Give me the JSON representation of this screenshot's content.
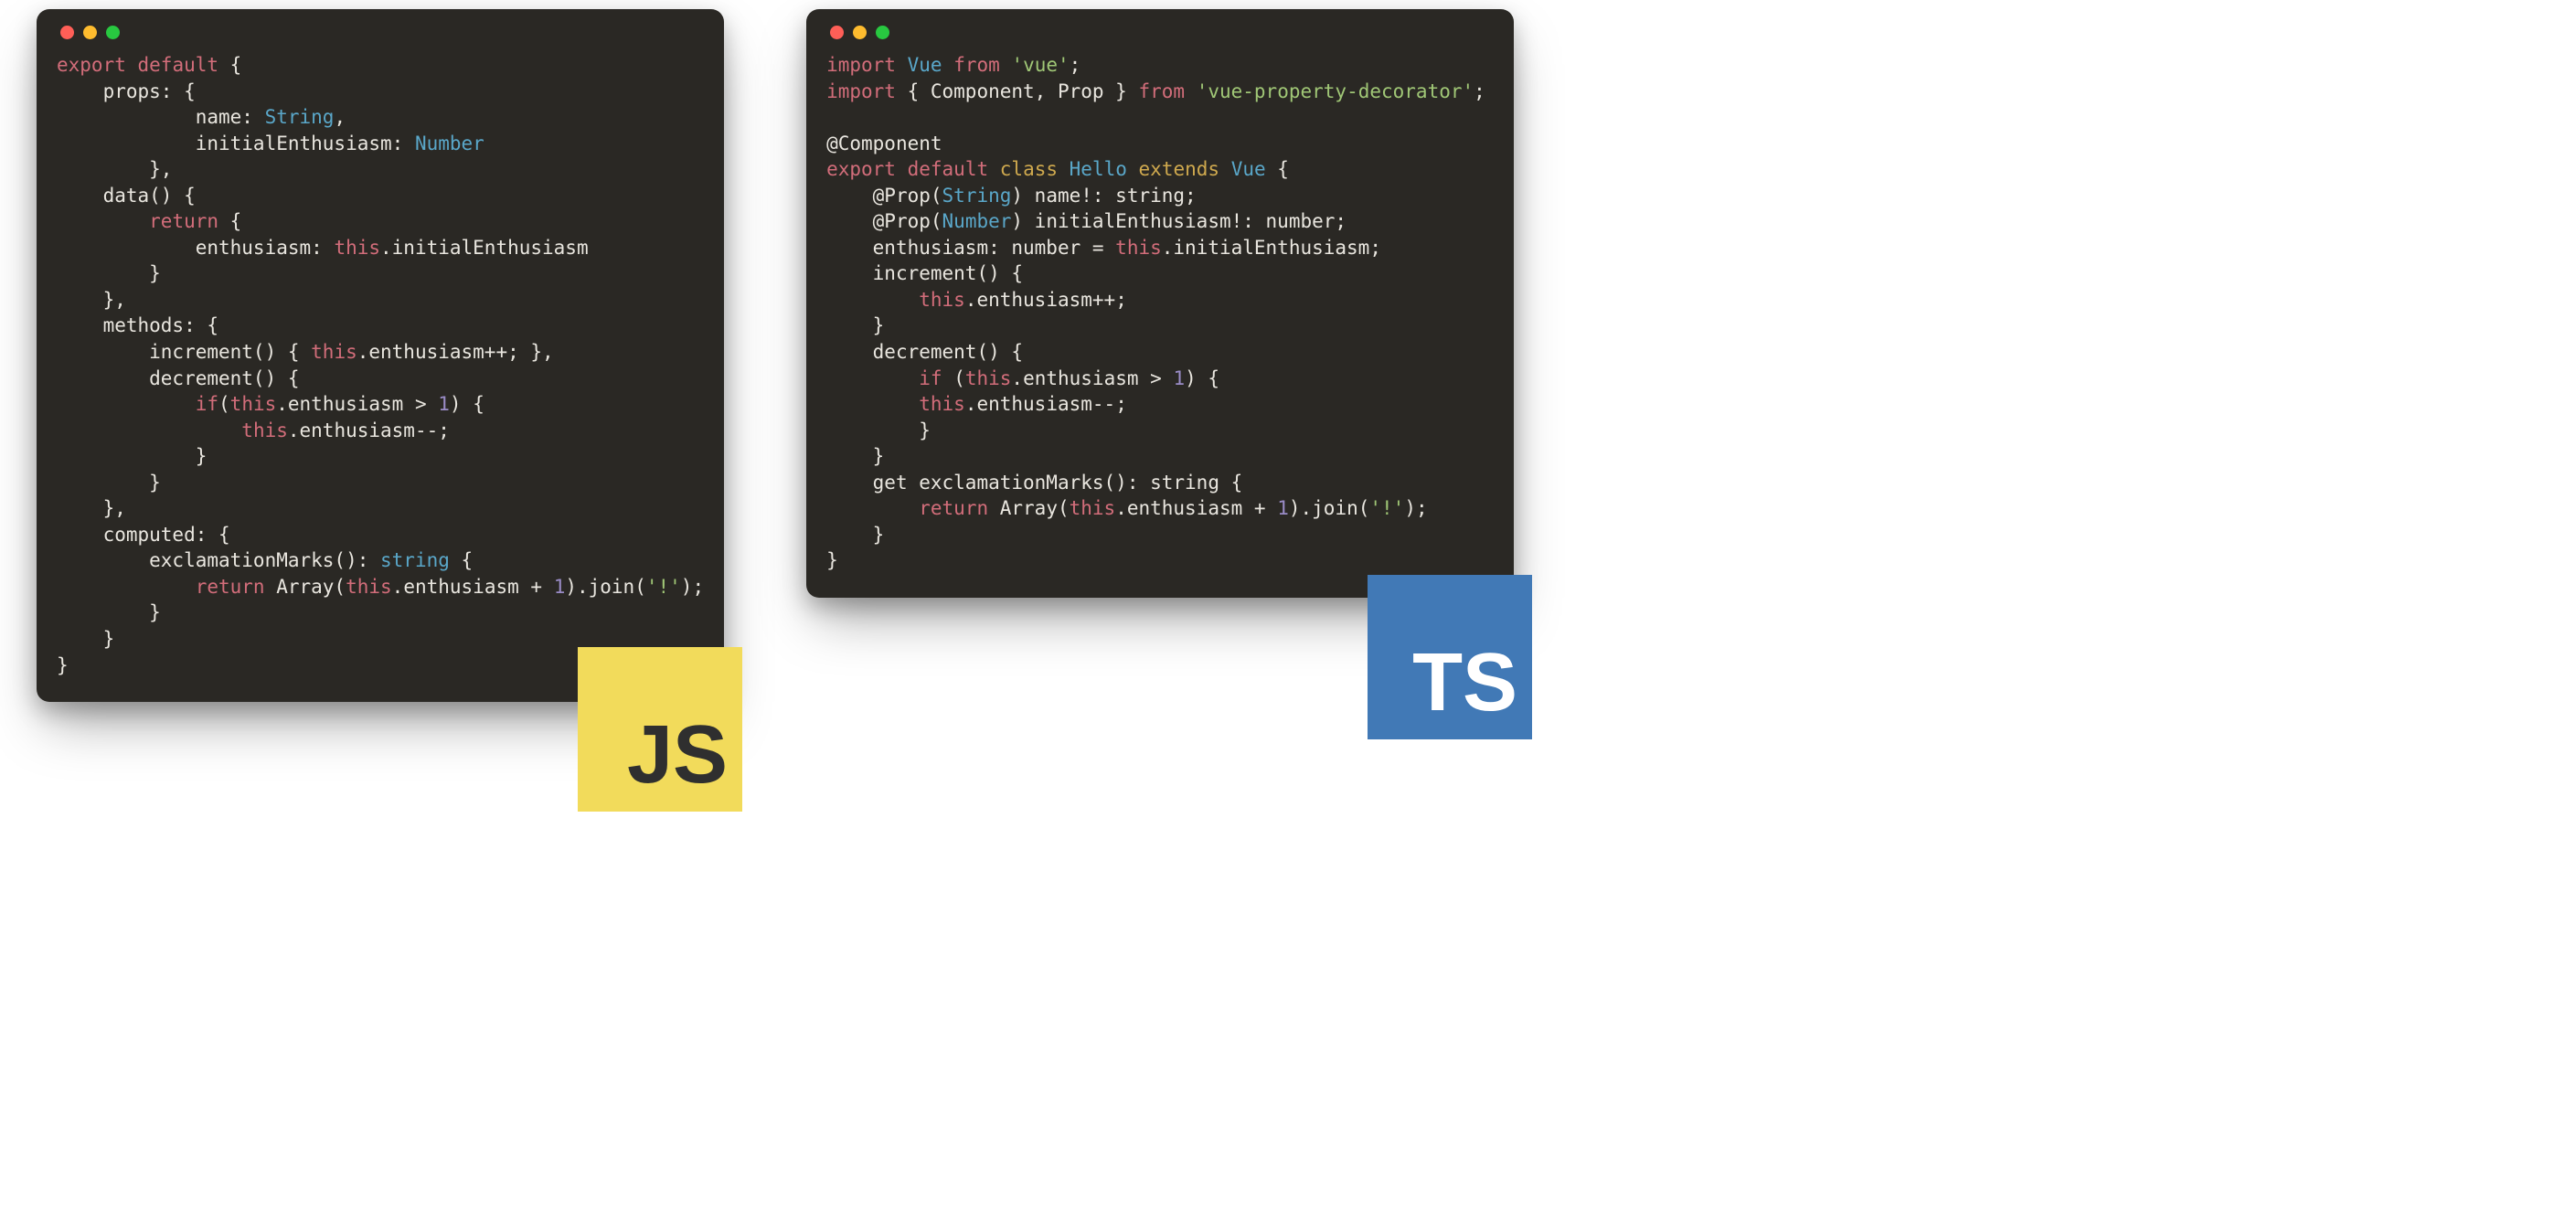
{
  "left": {
    "badge": "JS",
    "code": [
      [
        [
          "kw-red",
          "export"
        ],
        [
          "plain",
          " "
        ],
        [
          "kw-red",
          "default"
        ],
        [
          "plain",
          " {"
        ]
      ],
      [
        [
          "plain",
          "    props: {"
        ]
      ],
      [
        [
          "plain",
          "            name: "
        ],
        [
          "kw-blue",
          "String"
        ],
        [
          "plain",
          ","
        ]
      ],
      [
        [
          "plain",
          "            initialEnthusiasm: "
        ],
        [
          "kw-blue",
          "Number"
        ]
      ],
      [
        [
          "plain",
          "        },"
        ]
      ],
      [
        [
          "plain",
          "    data() {"
        ]
      ],
      [
        [
          "plain",
          "        "
        ],
        [
          "kw-red",
          "return"
        ],
        [
          "plain",
          " {"
        ]
      ],
      [
        [
          "plain",
          "            enthusiasm: "
        ],
        [
          "kw-red",
          "this"
        ],
        [
          "plain",
          ".initialEnthusiasm"
        ]
      ],
      [
        [
          "plain",
          "        }"
        ]
      ],
      [
        [
          "plain",
          "    },"
        ]
      ],
      [
        [
          "plain",
          "    methods: {"
        ]
      ],
      [
        [
          "plain",
          "        increment() { "
        ],
        [
          "kw-red",
          "this"
        ],
        [
          "plain",
          ".enthusiasm++; },"
        ]
      ],
      [
        [
          "plain",
          "        decrement() {"
        ]
      ],
      [
        [
          "plain",
          "            "
        ],
        [
          "kw-red",
          "if"
        ],
        [
          "plain",
          "("
        ],
        [
          "kw-red",
          "this"
        ],
        [
          "plain",
          ".enthusiasm > "
        ],
        [
          "kw-purple",
          "1"
        ],
        [
          "plain",
          ") {"
        ]
      ],
      [
        [
          "plain",
          "                "
        ],
        [
          "kw-red",
          "this"
        ],
        [
          "plain",
          ".enthusiasm--;"
        ]
      ],
      [
        [
          "plain",
          "            }"
        ]
      ],
      [
        [
          "plain",
          "        }"
        ]
      ],
      [
        [
          "plain",
          "    },"
        ]
      ],
      [
        [
          "plain",
          "    computed: {"
        ]
      ],
      [
        [
          "plain",
          "        exclamationMarks(): "
        ],
        [
          "kw-blue",
          "string"
        ],
        [
          "plain",
          " {"
        ]
      ],
      [
        [
          "plain",
          "            "
        ],
        [
          "kw-red",
          "return"
        ],
        [
          "plain",
          " Array("
        ],
        [
          "kw-red",
          "this"
        ],
        [
          "plain",
          ".enthusiasm + "
        ],
        [
          "kw-purple",
          "1"
        ],
        [
          "plain",
          ").join("
        ],
        [
          "str",
          "'!'"
        ],
        [
          "plain",
          ");"
        ]
      ],
      [
        [
          "plain",
          "        }"
        ]
      ],
      [
        [
          "plain",
          "    }"
        ]
      ],
      [
        [
          "plain",
          "}"
        ]
      ]
    ]
  },
  "right": {
    "badge": "TS",
    "code": [
      [
        [
          "kw-red",
          "import"
        ],
        [
          "plain",
          " "
        ],
        [
          "kw-blue",
          "Vue"
        ],
        [
          "plain",
          " "
        ],
        [
          "kw-red",
          "from"
        ],
        [
          "plain",
          " "
        ],
        [
          "str",
          "'vue'"
        ],
        [
          "plain",
          ";"
        ]
      ],
      [
        [
          "kw-red",
          "import"
        ],
        [
          "plain",
          " { Component, Prop } "
        ],
        [
          "kw-red",
          "from"
        ],
        [
          "plain",
          " "
        ],
        [
          "str",
          "'vue-property-decorator'"
        ],
        [
          "plain",
          ";"
        ]
      ],
      [
        [
          "plain",
          ""
        ]
      ],
      [
        [
          "plain",
          "@Component"
        ]
      ],
      [
        [
          "kw-red",
          "export"
        ],
        [
          "plain",
          " "
        ],
        [
          "kw-red",
          "default"
        ],
        [
          "plain",
          " "
        ],
        [
          "kw-yellow",
          "class"
        ],
        [
          "plain",
          " "
        ],
        [
          "kw-blue",
          "Hello"
        ],
        [
          "plain",
          " "
        ],
        [
          "kw-yellow",
          "extends"
        ],
        [
          "plain",
          " "
        ],
        [
          "kw-blue",
          "Vue"
        ],
        [
          "plain",
          " {"
        ]
      ],
      [
        [
          "plain",
          "    @Prop("
        ],
        [
          "kw-blue",
          "String"
        ],
        [
          "plain",
          ") name!: string;"
        ]
      ],
      [
        [
          "plain",
          "    @Prop("
        ],
        [
          "kw-blue",
          "Number"
        ],
        [
          "plain",
          ") initialEnthusiasm!: number;"
        ]
      ],
      [
        [
          "plain",
          "    enthusiasm: number = "
        ],
        [
          "kw-red",
          "this"
        ],
        [
          "plain",
          ".initialEnthusiasm;"
        ]
      ],
      [
        [
          "plain",
          "    increment() {"
        ]
      ],
      [
        [
          "plain",
          "        "
        ],
        [
          "kw-red",
          "this"
        ],
        [
          "plain",
          ".enthusiasm++;"
        ]
      ],
      [
        [
          "plain",
          "    }"
        ]
      ],
      [
        [
          "plain",
          "    decrement() {"
        ]
      ],
      [
        [
          "plain",
          "        "
        ],
        [
          "kw-red",
          "if"
        ],
        [
          "plain",
          " ("
        ],
        [
          "kw-red",
          "this"
        ],
        [
          "plain",
          ".enthusiasm > "
        ],
        [
          "kw-purple",
          "1"
        ],
        [
          "plain",
          ") {"
        ]
      ],
      [
        [
          "plain",
          "        "
        ],
        [
          "kw-red",
          "this"
        ],
        [
          "plain",
          ".enthusiasm--;"
        ]
      ],
      [
        [
          "plain",
          "        }"
        ]
      ],
      [
        [
          "plain",
          "    }"
        ]
      ],
      [
        [
          "plain",
          "    get exclamationMarks(): string {"
        ]
      ],
      [
        [
          "plain",
          "        "
        ],
        [
          "kw-red",
          "return"
        ],
        [
          "plain",
          " Array("
        ],
        [
          "kw-red",
          "this"
        ],
        [
          "plain",
          ".enthusiasm + "
        ],
        [
          "kw-purple",
          "1"
        ],
        [
          "plain",
          ").join("
        ],
        [
          "str",
          "'!'"
        ],
        [
          "plain",
          ");"
        ]
      ],
      [
        [
          "plain",
          "    }"
        ]
      ],
      [
        [
          "plain",
          "}"
        ]
      ]
    ]
  }
}
